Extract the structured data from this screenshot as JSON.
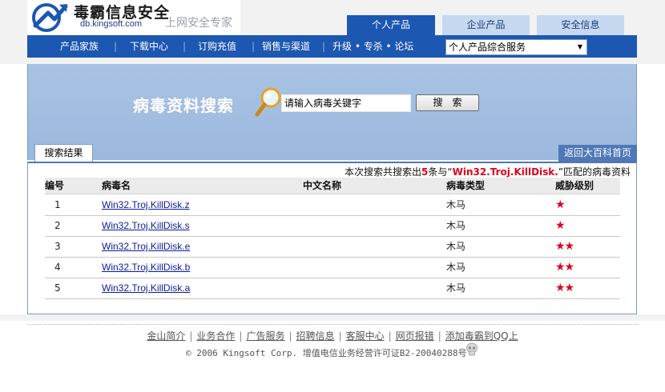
{
  "brand": {
    "name": "毒霸信息安全",
    "url": "db.kingsoft.com",
    "slogan": "上网安全专家"
  },
  "top_tabs": [
    "个人产品",
    "企业产品",
    "安全信息"
  ],
  "nav": {
    "items": [
      "产品家族",
      "下载中心",
      "订购充值",
      "销售与渠道",
      "升级 • 专杀 • 论坛"
    ],
    "separator": "|",
    "select_value": "个人产品综合服务"
  },
  "search": {
    "heading": "病毒资料搜索",
    "input_value": "请输入病毒关键字",
    "button_label": "搜　索"
  },
  "results": {
    "tab_label": "搜索结果",
    "back_link": "返回大百科首页",
    "summary": {
      "prefix": "本次搜索共搜索出",
      "count": "5",
      "middle": "条与“",
      "keyword": "Win32.Troj.KillDisk.",
      "suffix": "”匹配的病毒资料"
    },
    "columns": [
      "编号",
      "病毒名",
      "中文名称",
      "病毒类型",
      "威胁级别"
    ],
    "rows": [
      {
        "num": "1",
        "name": "Win32.Troj.KillDisk.z",
        "cn_name": "",
        "type": "木马",
        "threat": "★",
        "threat_level": 1
      },
      {
        "num": "2",
        "name": "Win32.Troj.KillDisk.s",
        "cn_name": "",
        "type": "木马",
        "threat": "★",
        "threat_level": 1
      },
      {
        "num": "3",
        "name": "Win32.Troj.KillDisk.e",
        "cn_name": "",
        "type": "木马",
        "threat": "★★",
        "threat_level": 2
      },
      {
        "num": "4",
        "name": "Win32.Troj.KillDisk.b",
        "cn_name": "",
        "type": "木马",
        "threat": "★★",
        "threat_level": 2
      },
      {
        "num": "5",
        "name": "Win32.Troj.KillDisk.a",
        "cn_name": "",
        "type": "木马",
        "threat": "★★",
        "threat_level": 2
      }
    ]
  },
  "footer": {
    "links": [
      "金山简介",
      "业务合作",
      "广告服务",
      "招聘信息",
      "客服中心",
      "网页报错",
      "添加毒霸到QQ上"
    ],
    "separator": "|",
    "copyright": "© 2006 Kingsoft Corp. 增值电信业务经营许可证B2-20040288号"
  },
  "colors": {
    "brand_blue": "#1c57b1",
    "tab_light": "#c6d9f1",
    "band_blue": "#a9c3e3",
    "threat_red": "#e0001b",
    "link_blue": "#0b1c9a"
  },
  "icons": [
    "kingsoft-logo-icon",
    "magnifier-icon",
    "dropdown-arrow-icon",
    "skull-icon"
  ]
}
